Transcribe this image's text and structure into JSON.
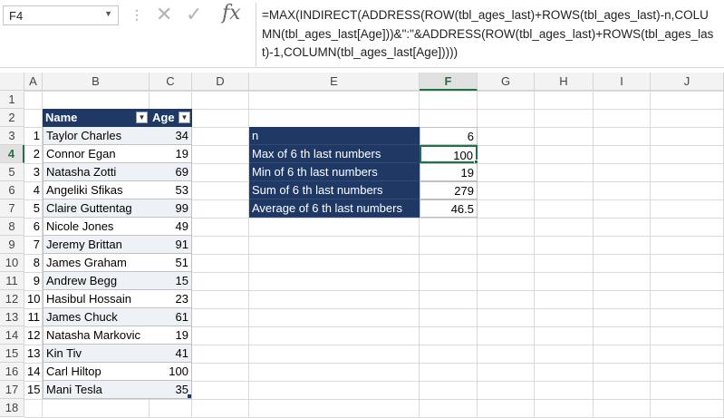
{
  "name_box": "F4",
  "formula_bar": {
    "formula": "=MAX(INDIRECT(ADDRESS(ROW(tbl_ages_last)+ROWS(tbl_ages_last)-n,COLUMN(tbl_ages_last[Age]))&\":\"&ADDRESS(ROW(tbl_ages_last)+ROWS(tbl_ages_last)-1,COLUMN(tbl_ages_last[Age]))))"
  },
  "columns": [
    "A",
    "B",
    "C",
    "D",
    "E",
    "F",
    "G",
    "H",
    "I",
    "J"
  ],
  "selected_column": "F",
  "rows": [
    "1",
    "2",
    "3",
    "4",
    "5",
    "6",
    "7",
    "8",
    "9",
    "10",
    "11",
    "12",
    "13",
    "14",
    "15",
    "16",
    "17",
    "18"
  ],
  "selected_row": "4",
  "table": {
    "headers": {
      "name": "Name",
      "age": "Age"
    },
    "rows": [
      {
        "idx": "1",
        "name": "Taylor Charles",
        "age": "34"
      },
      {
        "idx": "2",
        "name": "Connor Egan",
        "age": "19"
      },
      {
        "idx": "3",
        "name": "Natasha Zotti",
        "age": "69"
      },
      {
        "idx": "4",
        "name": "Angeliki Sfikas",
        "age": "53"
      },
      {
        "idx": "5",
        "name": "Claire Guttentag",
        "age": "99"
      },
      {
        "idx": "6",
        "name": "Nicole Jones",
        "age": "49"
      },
      {
        "idx": "7",
        "name": "Jeremy Brittan",
        "age": "91"
      },
      {
        "idx": "8",
        "name": "James Graham",
        "age": "51"
      },
      {
        "idx": "9",
        "name": "Andrew Begg",
        "age": "15"
      },
      {
        "idx": "10",
        "name": "Hasibul Hossain",
        "age": "23"
      },
      {
        "idx": "11",
        "name": "James Chuck",
        "age": "61"
      },
      {
        "idx": "12",
        "name": "Natasha Markovic",
        "age": "19"
      },
      {
        "idx": "13",
        "name": "Kin Tiv",
        "age": "41"
      },
      {
        "idx": "14",
        "name": "Carl Hiltop",
        "age": "100"
      },
      {
        "idx": "15",
        "name": "Mani Tesla",
        "age": "35"
      }
    ]
  },
  "summary": [
    {
      "label": "n",
      "value": "6"
    },
    {
      "label": "Max of 6 th last numbers",
      "value": "100"
    },
    {
      "label": "Min of 6 th last numbers",
      "value": "19"
    },
    {
      "label": "Sum of 6 th last numbers",
      "value": "279"
    },
    {
      "label": "Average of 6 th last numbers",
      "value": "46.5"
    }
  ],
  "colors": {
    "table_header": "#1f3864",
    "selection": "#217346"
  },
  "icons": {
    "cancel": "cancel-icon",
    "enter": "check-icon",
    "function": "fx-icon",
    "dropdown": "chevron-down-icon"
  }
}
